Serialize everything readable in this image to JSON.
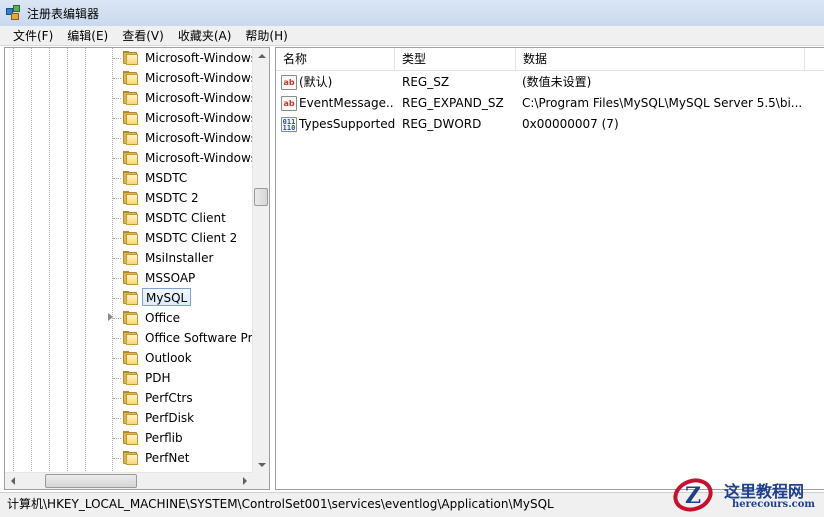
{
  "window": {
    "title": "注册表编辑器"
  },
  "menu": [
    "文件(F)",
    "编辑(E)",
    "查看(V)",
    "收藏夹(A)",
    "帮助(H)"
  ],
  "tree": {
    "items": [
      {
        "label": "Microsoft-Windows",
        "expandable": false,
        "selected": false
      },
      {
        "label": "Microsoft-Windows",
        "expandable": false,
        "selected": false
      },
      {
        "label": "Microsoft-Windows",
        "expandable": false,
        "selected": false
      },
      {
        "label": "Microsoft-Windows",
        "expandable": false,
        "selected": false
      },
      {
        "label": "Microsoft-Windows",
        "expandable": false,
        "selected": false
      },
      {
        "label": "Microsoft-Windows",
        "expandable": false,
        "selected": false
      },
      {
        "label": "MSDTC",
        "expandable": false,
        "selected": false
      },
      {
        "label": "MSDTC 2",
        "expandable": false,
        "selected": false
      },
      {
        "label": "MSDTC Client",
        "expandable": false,
        "selected": false
      },
      {
        "label": "MSDTC Client 2",
        "expandable": false,
        "selected": false
      },
      {
        "label": "MsiInstaller",
        "expandable": false,
        "selected": false
      },
      {
        "label": "MSSOAP",
        "expandable": false,
        "selected": false
      },
      {
        "label": "MySQL",
        "expandable": false,
        "selected": true
      },
      {
        "label": "Office",
        "expandable": true,
        "selected": false
      },
      {
        "label": "Office Software Pro",
        "expandable": false,
        "selected": false
      },
      {
        "label": "Outlook",
        "expandable": false,
        "selected": false
      },
      {
        "label": "PDH",
        "expandable": false,
        "selected": false
      },
      {
        "label": "PerfCtrs",
        "expandable": false,
        "selected": false
      },
      {
        "label": "PerfDisk",
        "expandable": false,
        "selected": false
      },
      {
        "label": "Perflib",
        "expandable": false,
        "selected": false
      },
      {
        "label": "PerfNet",
        "expandable": false,
        "selected": false
      }
    ]
  },
  "list": {
    "columns": [
      "名称",
      "类型",
      "数据"
    ],
    "rows": [
      {
        "icon": "string-value-icon",
        "icon_text": "ab",
        "name": "(默认)",
        "type": "REG_SZ",
        "data": "(数值未设置)"
      },
      {
        "icon": "string-value-icon",
        "icon_text": "ab",
        "name": "EventMessage...",
        "type": "REG_EXPAND_SZ",
        "data": "C:\\Program Files\\MySQL\\MySQL Server 5.5\\bi..."
      },
      {
        "icon": "binary-value-icon",
        "icon_text": "011\n110",
        "name": "TypesSupported",
        "type": "REG_DWORD",
        "data": "0x00000007 (7)"
      }
    ]
  },
  "status": {
    "path": "计算机\\HKEY_LOCAL_MACHINE\\SYSTEM\\ControlSet001\\services\\eventlog\\Application\\MySQL"
  },
  "watermark": {
    "cn": "这里教程网",
    "en": "herecours.com",
    "logo_letter": "Z"
  },
  "colors": {
    "selection_border": "#7da2ce",
    "folder": "#e0b24a",
    "watermark": "#1e3f8f",
    "watermark_red": "#c8102e"
  }
}
